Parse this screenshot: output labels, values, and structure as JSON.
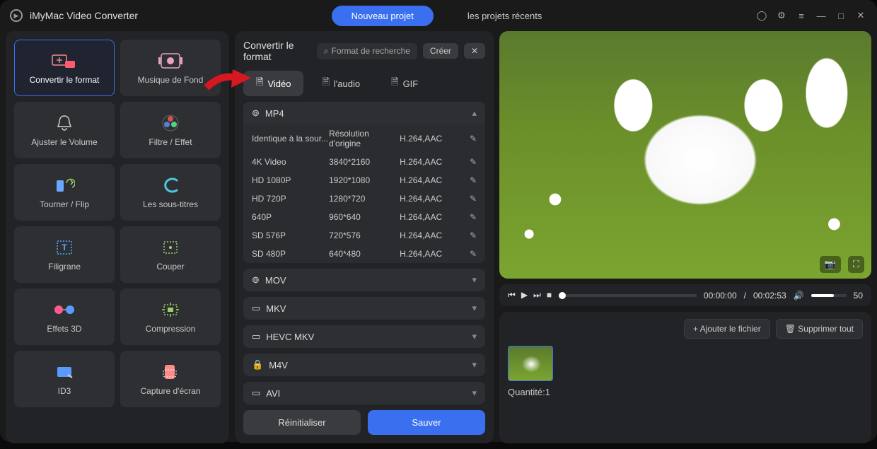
{
  "titlebar": {
    "app": "iMyMac Video Converter"
  },
  "header": {
    "new_project": "Nouveau projet",
    "recent_projects": "les projets récents"
  },
  "sidebar": {
    "items": [
      {
        "label": "Convertir le format"
      },
      {
        "label": "Musique de Fond"
      },
      {
        "label": "Ajuster le Volume"
      },
      {
        "label": "Filtre / Effet"
      },
      {
        "label": "Tourner / Flip"
      },
      {
        "label": "Les sous-titres"
      },
      {
        "label": "Filigrane"
      },
      {
        "label": "Couper"
      },
      {
        "label": "Effets 3D"
      },
      {
        "label": "Compression"
      },
      {
        "label": "ID3"
      },
      {
        "label": "Capture d'écran"
      }
    ]
  },
  "center": {
    "title": "Convertir le format",
    "search_ph": "Format de recherche",
    "create": "Créer",
    "tabs": {
      "video": "Vidéo",
      "audio": "l'audio",
      "gif": "GIF"
    },
    "mp4": "MP4",
    "presets": [
      {
        "name": "Identique à la sour...",
        "res": "Résolution d'origine",
        "codec": "H.264,AAC"
      },
      {
        "name": "4K Video",
        "res": "3840*2160",
        "codec": "H.264,AAC"
      },
      {
        "name": "HD 1080P",
        "res": "1920*1080",
        "codec": "H.264,AAC"
      },
      {
        "name": "HD 720P",
        "res": "1280*720",
        "codec": "H.264,AAC"
      },
      {
        "name": "640P",
        "res": "960*640",
        "codec": "H.264,AAC"
      },
      {
        "name": "SD 576P",
        "res": "720*576",
        "codec": "H.264,AAC"
      },
      {
        "name": "SD 480P",
        "res": "640*480",
        "codec": "H.264,AAC"
      }
    ],
    "groups": {
      "mov": "MOV",
      "mkv": "MKV",
      "hevc": "HEVC MKV",
      "m4v": "M4V",
      "avi": "AVI"
    },
    "reset": "Réinitialiser",
    "save": "Sauver"
  },
  "player": {
    "current": "00:00:00",
    "total": "00:02:53",
    "vol": "50"
  },
  "files": {
    "add": "Ajouter le fichier",
    "remove": "Supprimer tout",
    "qty_label": "Quantité:",
    "qty": "1"
  }
}
